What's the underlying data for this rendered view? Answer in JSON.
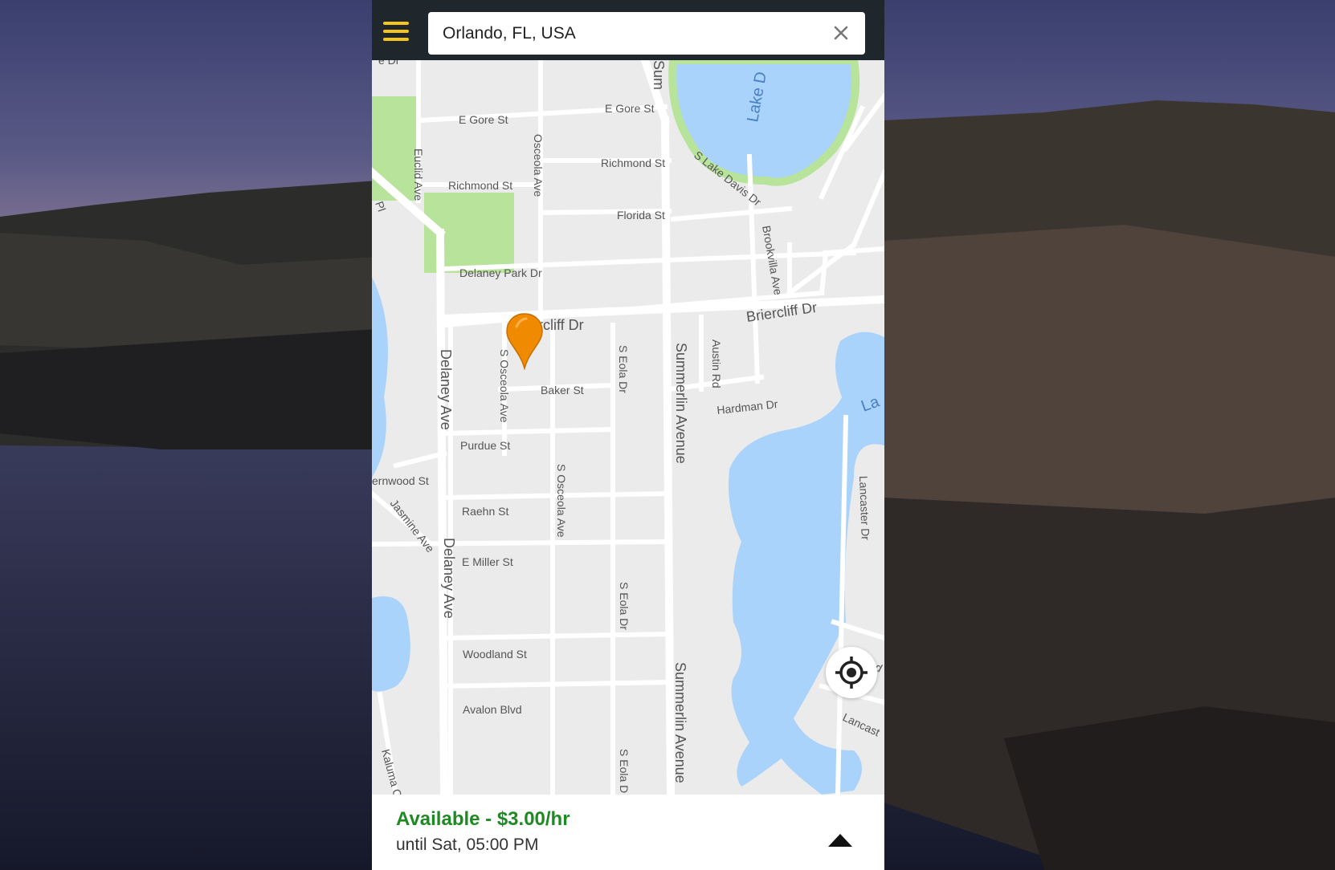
{
  "search": {
    "value": "Orlando, FL, USA"
  },
  "icons": {
    "menu": "hamburger-menu-icon",
    "clear": "close-icon",
    "locate": "crosshair-locate-icon",
    "pin": "map-pin-icon",
    "expand": "triangle-up-icon"
  },
  "colors": {
    "menu_accent": "#f5c518",
    "topbar": "#20272c",
    "available": "#1d8a22",
    "pin": "#f08a00",
    "water": "#aad3fb",
    "park": "#b7e39a"
  },
  "map": {
    "streets": {
      "e_gore_st_left": "E Gore St",
      "e_gore_st_right": "E Gore St",
      "richmond_st_left": "Richmond St",
      "richmond_st_right": "Richmond St",
      "florida_st": "Florida St",
      "delaney_park_dr": "Delaney Park Dr",
      "briercliff_dr_left": "rcliff Dr",
      "briercliff_dr_right": "Briercliff Dr",
      "baker_st": "Baker St",
      "purdue_st": "Purdue St",
      "fernwood_st": "ernwood St",
      "raehn_st": "Raehn St",
      "e_miller_st": "E Miller St",
      "woodland_st": "Woodland St",
      "avalon_blvd": "Avalon Blvd",
      "hardman_dr": "Hardman Dr",
      "euclid_ave": "Euclid Ave",
      "osceola_ave_top": "Osceola Ave",
      "s_osceola_ave_mid": "S Osceola Ave",
      "s_osceola_ave_low": "S Osceola Ave",
      "delaney_ave_top": "Delaney Ave",
      "delaney_ave_bottom": "Delaney Ave",
      "s_eola_dr_top": "S Eola Dr",
      "s_eola_dr_mid": "S Eola Dr",
      "s_eola_dr_bottom": "S Eola D",
      "summerlin_top": "Summerlin Avenue",
      "summerlin_bottom": "Summerlin Avenue",
      "sum_top_edge": "Sum",
      "austin_rd": "Austin Rd",
      "brookvilla_ave": "Brookvilla Ave",
      "s_lake_davis_dr": "S Lake Davis Dr",
      "lancaster_dr": "Lancaster Dr",
      "lancaster_bottom": "Lancast",
      "jasmine_ave": "Jasmine Ave",
      "kaluma": "Kaluma C",
      "wood_right": "Wood",
      "pl_edge": "Pl",
      "st_dr_top_edge": "e Dr"
    },
    "water_labels": {
      "lake_davis": "Lake D",
      "lake_right": "La"
    }
  },
  "status": {
    "title": "Available - $3.00/hr",
    "subtitle": "until Sat, 05:00 PM"
  }
}
